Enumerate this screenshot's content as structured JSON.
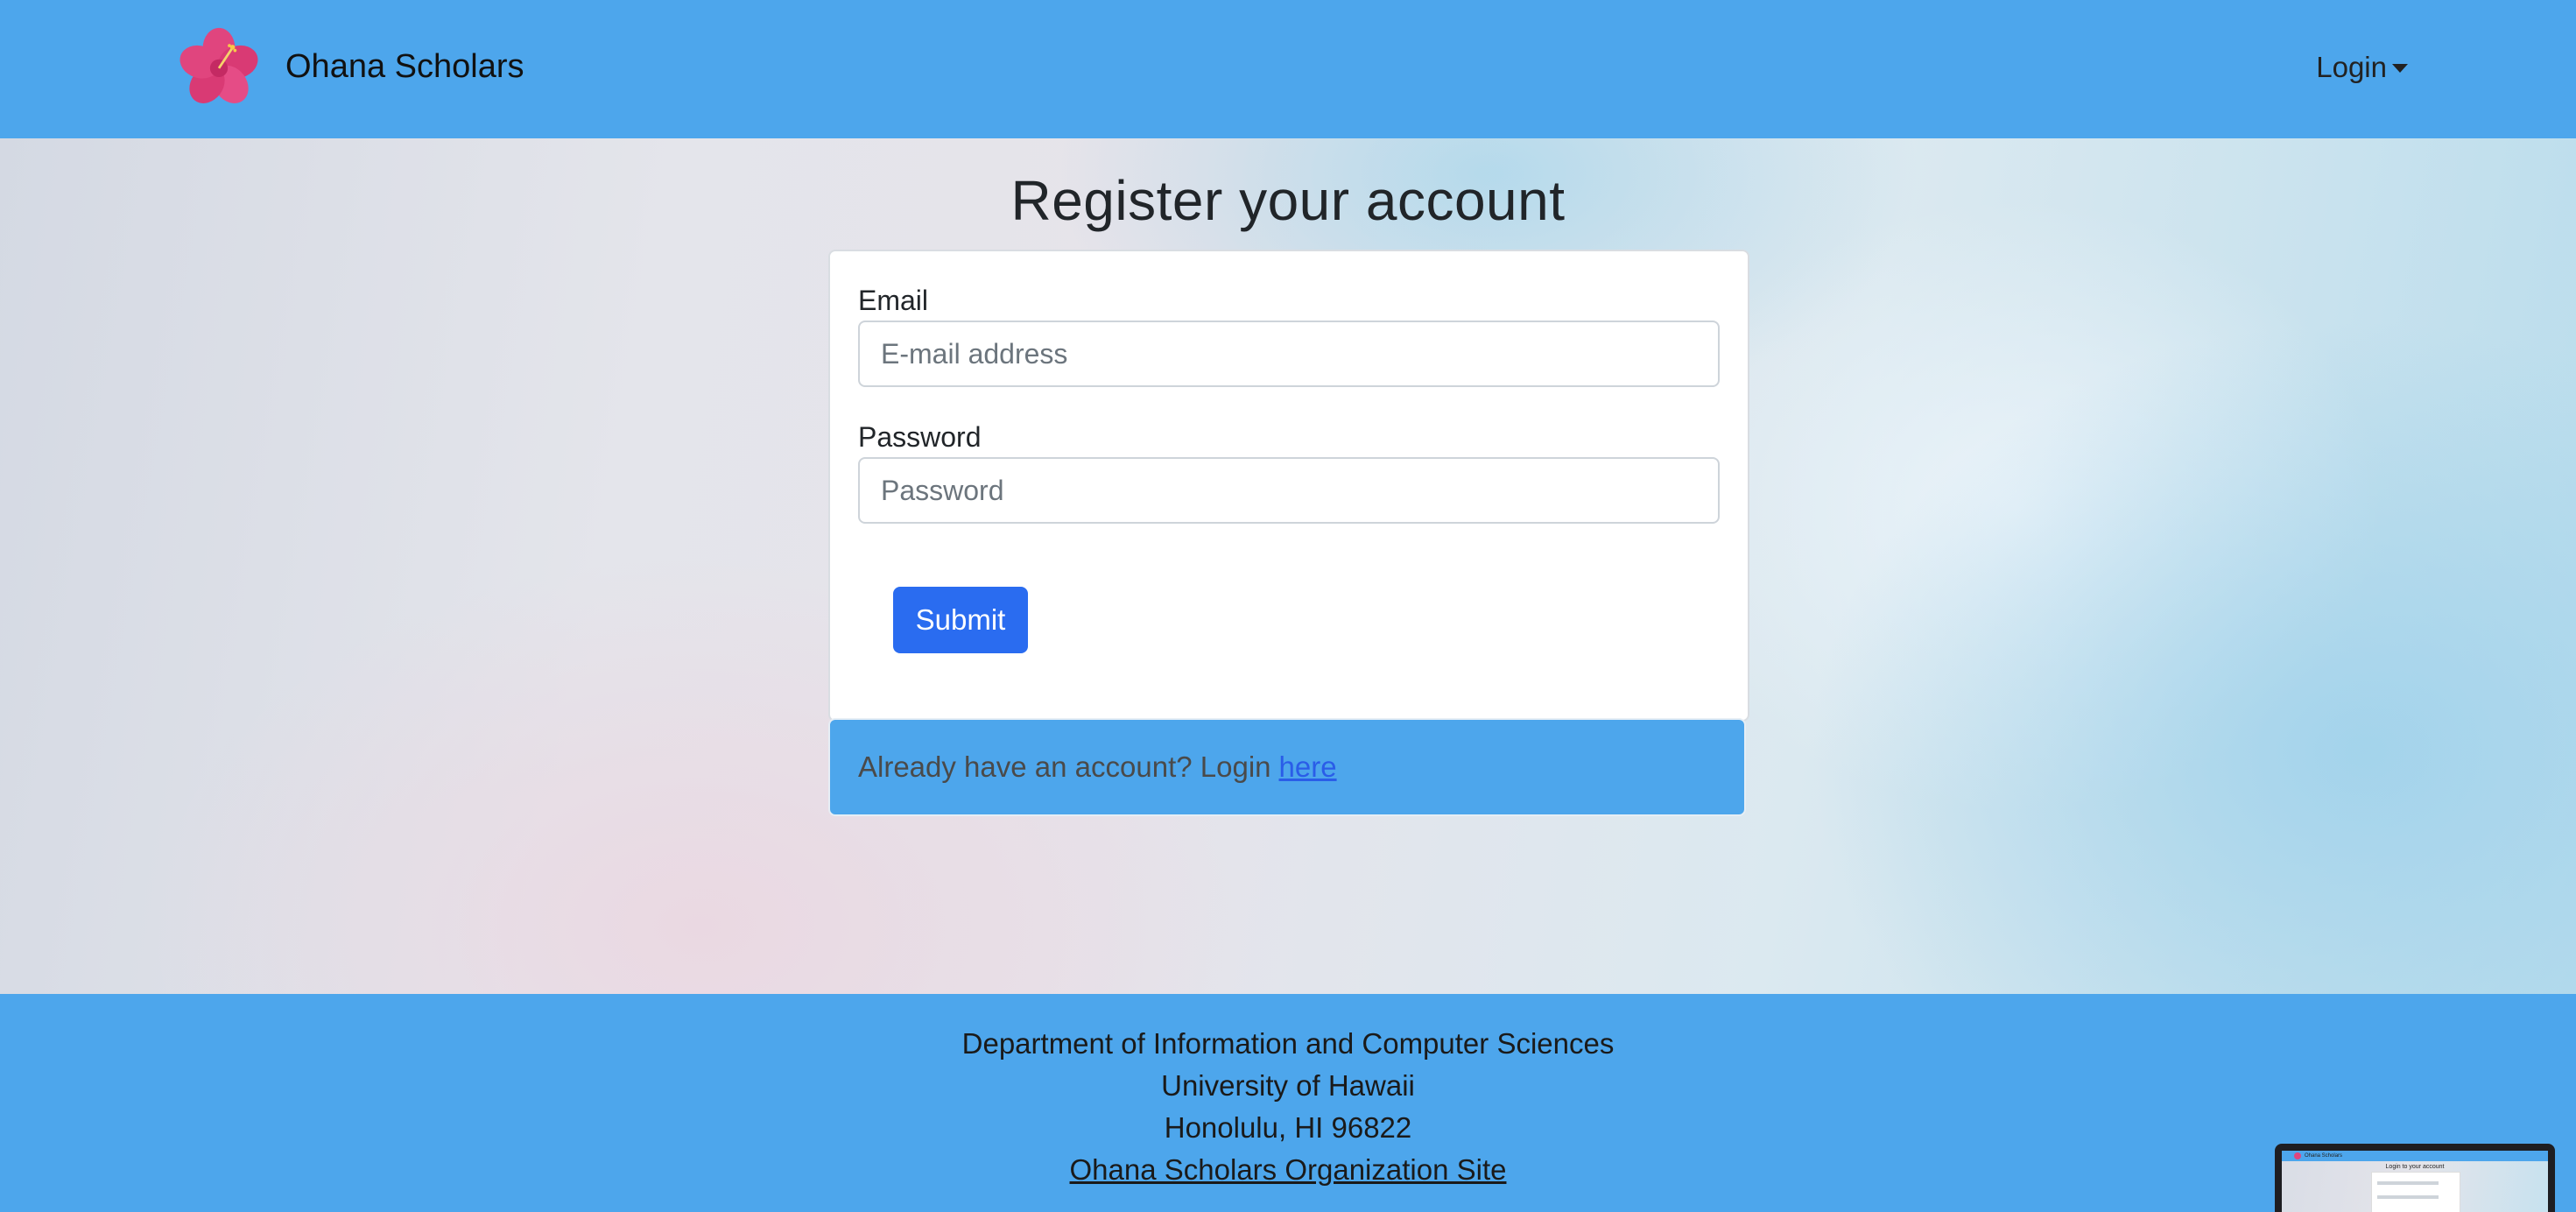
{
  "colors": {
    "navbar_bg": "#4da6ec",
    "footer_bg": "#4da6ec",
    "primary_button": "#2a6cf0",
    "link": "#2a5de8"
  },
  "navbar": {
    "brand_name": "Ohana Scholars",
    "logo_icon": "hibiscus-flower-icon",
    "login_label": "Login"
  },
  "main": {
    "title": "Register your account",
    "form": {
      "email_label": "Email",
      "email_placeholder": "E-mail address",
      "email_value": "",
      "password_label": "Password",
      "password_placeholder": "Password",
      "password_value": "",
      "submit_label": "Submit"
    },
    "login_prompt": {
      "text": "Already have an account? Login",
      "link_text": "here"
    }
  },
  "footer": {
    "line1": "Department of Information and Computer Sciences",
    "line2": "University of Hawaii",
    "line3": "Honolulu, HI 96822",
    "link_text": "Ohana Scholars Organization Site"
  },
  "thumbnail": {
    "brand_name": "Ohana Scholars",
    "title": "Login to your account"
  }
}
